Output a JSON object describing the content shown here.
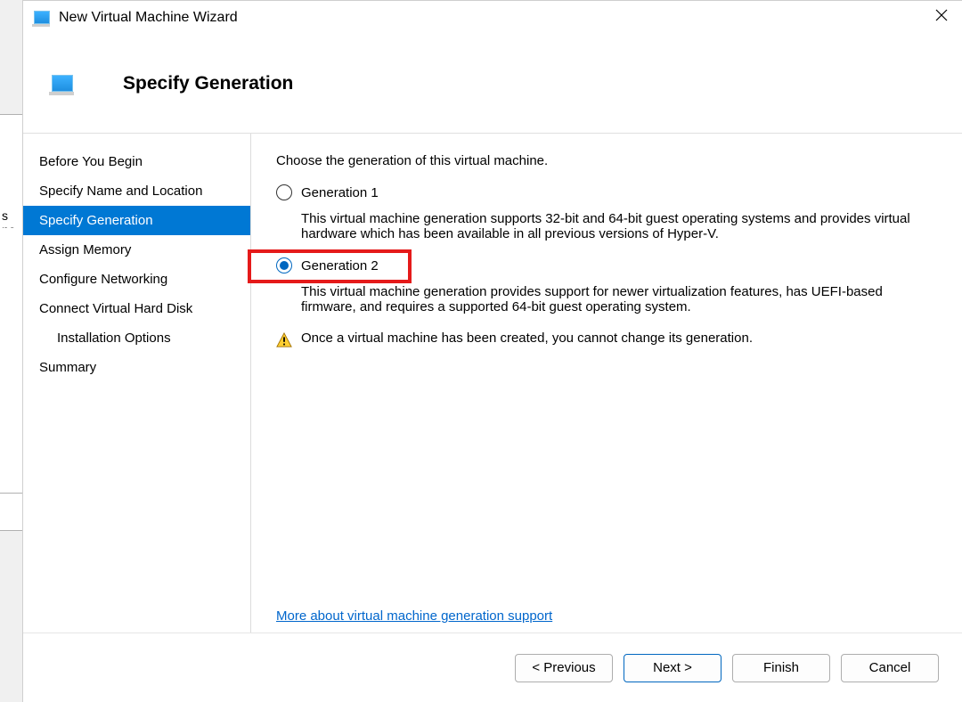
{
  "background": {
    "fragment_text": "s no"
  },
  "titlebar": {
    "title": "New Virtual Machine Wizard"
  },
  "header": {
    "title": "Specify Generation"
  },
  "sidebar": {
    "items": [
      {
        "label": "Before You Begin",
        "selected": false,
        "indent": false
      },
      {
        "label": "Specify Name and Location",
        "selected": false,
        "indent": false
      },
      {
        "label": "Specify Generation",
        "selected": true,
        "indent": false
      },
      {
        "label": "Assign Memory",
        "selected": false,
        "indent": false
      },
      {
        "label": "Configure Networking",
        "selected": false,
        "indent": false
      },
      {
        "label": "Connect Virtual Hard Disk",
        "selected": false,
        "indent": false
      },
      {
        "label": "Installation Options",
        "selected": false,
        "indent": true
      },
      {
        "label": "Summary",
        "selected": false,
        "indent": false
      }
    ]
  },
  "content": {
    "instruction": "Choose the generation of this virtual machine.",
    "options": [
      {
        "label": "Generation 1",
        "selected": false,
        "description": "This virtual machine generation supports 32-bit and 64-bit guest operating systems and provides virtual hardware which has been available in all previous versions of Hyper-V."
      },
      {
        "label": "Generation 2",
        "selected": true,
        "description": "This virtual machine generation provides support for newer virtualization features, has UEFI-based firmware, and requires a supported 64-bit guest operating system."
      }
    ],
    "warning": "Once a virtual machine has been created, you cannot change its generation.",
    "link": "More about virtual machine generation support"
  },
  "footer": {
    "previous": "< Previous",
    "next": "Next >",
    "finish": "Finish",
    "cancel": "Cancel"
  }
}
